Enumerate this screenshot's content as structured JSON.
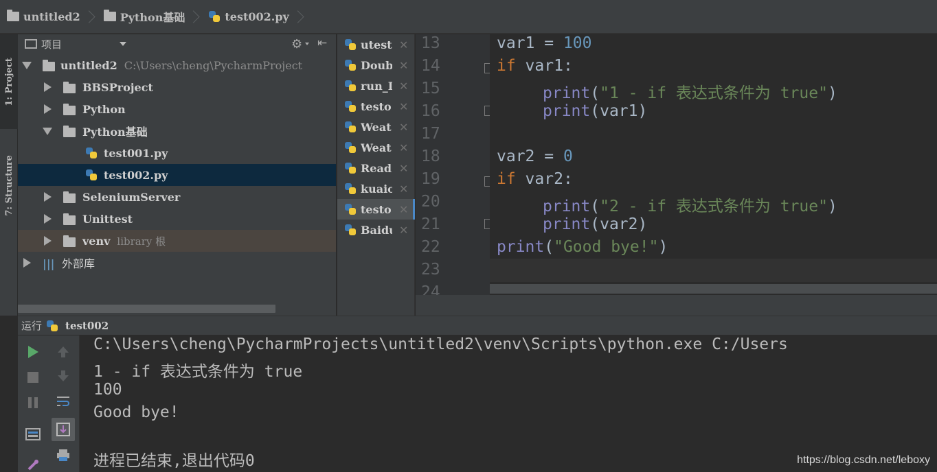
{
  "breadcrumb": {
    "items": [
      {
        "label": "untitled2",
        "icon": "folder-icon"
      },
      {
        "label": "Python基础",
        "icon": "folder-icon"
      },
      {
        "label": "test002.py",
        "icon": "python-file-icon"
      }
    ]
  },
  "tool_strip": {
    "project_tab": "1: Project",
    "structure_tab": "7: Structure"
  },
  "project_panel": {
    "view_label": "项目",
    "root": {
      "label": "untitled2",
      "path": "C:\\Users\\cheng\\PycharmProject"
    },
    "items": [
      {
        "label": "BBSProject",
        "extra": ""
      },
      {
        "label": "Python",
        "extra": ""
      },
      {
        "label": "Python基础",
        "extra": ""
      },
      {
        "label": "test001.py",
        "extra": ""
      },
      {
        "label": "test002.py",
        "extra": ""
      },
      {
        "label": "SeleniumServer",
        "extra": ""
      },
      {
        "label": "Unittest",
        "extra": ""
      },
      {
        "label": "venv",
        "extra": "library 根"
      },
      {
        "label": "外部库",
        "extra": ""
      }
    ]
  },
  "open_files": [
    {
      "label": "utest"
    },
    {
      "label": "Doub"
    },
    {
      "label": "run_I"
    },
    {
      "label": "testo"
    },
    {
      "label": "Weat"
    },
    {
      "label": "Weat"
    },
    {
      "label": "Read"
    },
    {
      "label": "kuaio"
    },
    {
      "label": "testo"
    },
    {
      "label": "Baidu"
    }
  ],
  "editor": {
    "line_numbers": [
      "13",
      "14",
      "15",
      "16",
      "17",
      "18",
      "19",
      "20",
      "21",
      "22",
      "23",
      "24"
    ],
    "code": {
      "l13": {
        "a": "var1 = ",
        "b": "100"
      },
      "l14": {
        "kw": "if",
        "rest": " var1:"
      },
      "l15": {
        "fn": "print",
        "open": "(",
        "str": "\"1 - if 表达式条件为 true\"",
        "close": ")"
      },
      "l16": {
        "fn": "print",
        "rest": "(var1)"
      },
      "l18": {
        "a": "var2 = ",
        "b": "0"
      },
      "l19": {
        "kw": "if",
        "rest": " var2:"
      },
      "l20": {
        "fn": "print",
        "open": "(",
        "str": "\"2 - if 表达式条件为 true\"",
        "close": ")"
      },
      "l21": {
        "fn": "print",
        "rest": "(var2)"
      },
      "l22": {
        "fn": "print",
        "open": "(",
        "str": "\"Good bye!\"",
        "close": ")"
      }
    }
  },
  "run_panel": {
    "label": "运行",
    "config": "test002",
    "output": [
      "C:\\Users\\cheng\\PycharmProjects\\untitled2\\venv\\Scripts\\python.exe C:/Users",
      "1 - if 表达式条件为 true",
      "100",
      "Good bye!",
      "",
      "进程已结束,退出代码0"
    ]
  },
  "watermark": "https://blog.csdn.net/leboxy",
  "colors": {
    "background": "#2b2b2b",
    "panel": "#3c3f41",
    "keyword": "#cc7832",
    "number": "#6897bb",
    "builtin": "#8888c6",
    "string": "#6a8759",
    "run_green": "#59a869",
    "selection": "#0d293e"
  }
}
